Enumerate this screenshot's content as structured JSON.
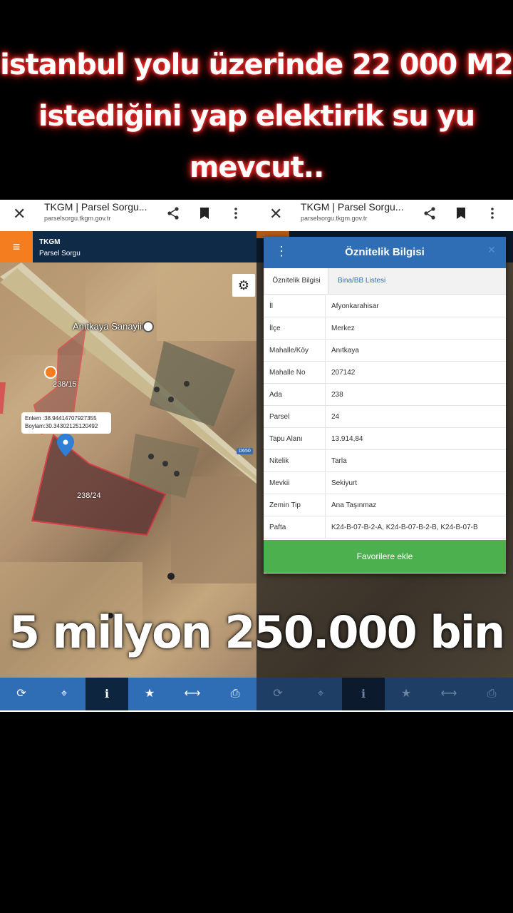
{
  "caption": {
    "line1": "istanbul yolu üzerinde 22 000 M2",
    "line2": "istediğini yap elektirik su yu",
    "line3": "mevcut.."
  },
  "price_overlay": "5 milyon 250.000 bin",
  "browser": {
    "close_glyph": "✕",
    "title": "TKGM | Parsel Sorgu...",
    "url": "parselsorgu.tkgm.gov.tr",
    "icons": [
      "share-icon",
      "bookmark-icon",
      "more-vert-icon"
    ]
  },
  "app": {
    "menu_glyph": "≡",
    "brand_line1": "TKGM",
    "brand_line2": "Parsel Sorgu",
    "accent_color": "#f47d20",
    "header_color": "#0f2a47"
  },
  "map": {
    "place_label": "Anıtkaya Sanayii",
    "parcel_a": "238/15",
    "parcel_b": "238/24",
    "coords": {
      "enlem": "Enlem :38.94414707927355",
      "boylam": "Boylam:30.34302125120492"
    },
    "road_sign": "D650",
    "gear_glyph": "⚙"
  },
  "toolbar": {
    "items": [
      {
        "glyph": "⟳",
        "icon": "refresh-icon"
      },
      {
        "glyph": "⌖",
        "icon": "locate-icon"
      },
      {
        "glyph": "i",
        "icon": "info-icon"
      },
      {
        "glyph": "★",
        "icon": "star-icon"
      },
      {
        "glyph": "⟷",
        "icon": "measure-icon"
      },
      {
        "glyph": "⎙",
        "icon": "print-icon"
      }
    ],
    "active_index": 2
  },
  "modal": {
    "dots": "⋮",
    "title": "Öznitelik Bilgisi",
    "close_glyph": "✕",
    "tabs": [
      "Öznitelik Bilgisi",
      "Bina/BB Listesi"
    ],
    "rows": [
      {
        "key": "İl",
        "value": "Afyonkarahisar"
      },
      {
        "key": "İlçe",
        "value": "Merkez"
      },
      {
        "key": "Mahalle/Köy",
        "value": "Anıtkaya"
      },
      {
        "key": "Mahalle No",
        "value": "207142"
      },
      {
        "key": "Ada",
        "value": "238"
      },
      {
        "key": "Parsel",
        "value": "24"
      },
      {
        "key": "Tapu Alanı",
        "value": "13.914,84"
      },
      {
        "key": "Nitelik",
        "value": "Tarla"
      },
      {
        "key": "Mevkii",
        "value": "Sekiyurt"
      },
      {
        "key": "Zemin Tip",
        "value": "Ana Taşınmaz"
      },
      {
        "key": "Pafta",
        "value": "K24-B-07-B-2-A, K24-B-07-B-2-B, K24-B-07-B"
      }
    ],
    "button": "Favorilere ekle",
    "button_color": "#4cb04e"
  }
}
